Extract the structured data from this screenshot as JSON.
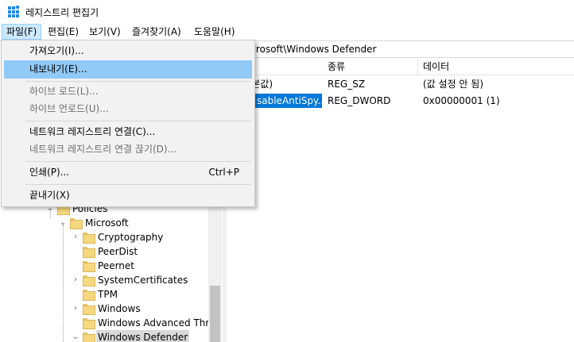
{
  "window": {
    "title": "레지스트리 편집기",
    "icon": "registry-editor-icon"
  },
  "menubar": {
    "items": [
      {
        "label": "파일(F)"
      },
      {
        "label": "편집(E)"
      },
      {
        "label": "보기(V)"
      },
      {
        "label": "즐겨찾기(A)"
      },
      {
        "label": "도움말(H)"
      }
    ]
  },
  "address": {
    "path_visible": "icrosoft\\Windows Defender"
  },
  "file_menu": {
    "items": [
      {
        "label": "가져오기(I)..."
      },
      {
        "label": "내보내기(E)..."
      },
      {
        "label": "하이브 로드(L)..."
      },
      {
        "label": "하이브 언로드(U)..."
      },
      {
        "label": "네트워크 레지스트리 연결(C)..."
      },
      {
        "label": "네트워크 레지스트리 연결 끊기(D)..."
      },
      {
        "label": "인쇄(P)...",
        "shortcut": "Ctrl+P"
      },
      {
        "label": "끝내기(X)"
      }
    ]
  },
  "tree": {
    "items": [
      {
        "label": "Policies"
      },
      {
        "label": "Microsoft"
      },
      {
        "label": "Cryptography"
      },
      {
        "label": "PeerDist"
      },
      {
        "label": "Peernet"
      },
      {
        "label": "SystemCertificates"
      },
      {
        "label": "TPM"
      },
      {
        "label": "Windows"
      },
      {
        "label": "Windows Advanced Threa"
      },
      {
        "label": "Windows Defender"
      }
    ]
  },
  "values_pane": {
    "columns": [
      "종류",
      "데이터"
    ],
    "rows": [
      {
        "name": "l본값)",
        "type": "REG_SZ",
        "data": "(값 설정 안 됨)"
      },
      {
        "name": "sableAntiSpy...",
        "type": "REG_DWORD",
        "data": "0x00000001 (1)"
      }
    ]
  },
  "colors": {
    "menu_hover": "#91c9f7",
    "selection": "#0078d7",
    "menu_active": "#cce8ff"
  }
}
